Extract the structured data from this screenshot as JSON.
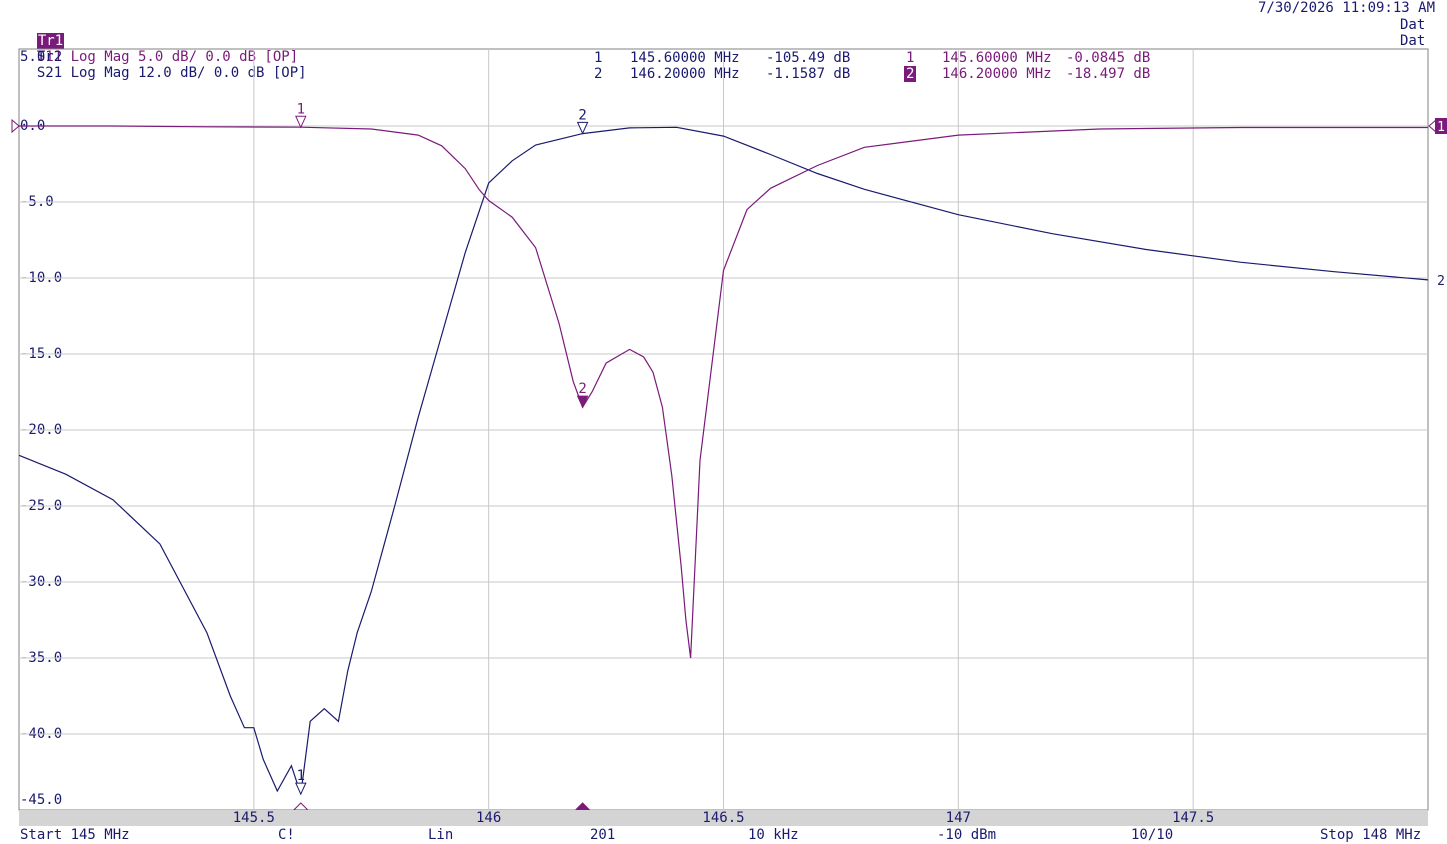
{
  "header": {
    "datetime": "7/30/2026 11:09:13 AM",
    "traces": [
      {
        "badge": "Tr1",
        "text": "S11 Log Mag 5.0 dB/ 0.0 dB [OP]",
        "right": "Dat"
      },
      {
        "badge": "Tr2",
        "text": "S21 Log Mag 12.0 dB/ 0.0 dB [OP]",
        "right": "Dat"
      }
    ]
  },
  "marker_table": {
    "tr2": [
      {
        "num": "1",
        "freq": "145.60000 MHz",
        "val": "-105.49 dB"
      },
      {
        "num": "2",
        "freq": "146.20000 MHz",
        "val": "-1.1587 dB"
      }
    ],
    "tr1": [
      {
        "num": "1",
        "freq": "145.60000 MHz",
        "val": "-0.0845 dB"
      },
      {
        "num": "2",
        "freq": "146.20000 MHz",
        "val": "-18.497 dB"
      }
    ]
  },
  "colors": {
    "tr1": "#7a1a7a",
    "tr2": "#1a1a6e",
    "grid": "#c8c8c8",
    "frame": "#808080",
    "xbar": "#d4d4d4"
  },
  "ref_labels": {
    "tr1": "1",
    "tr2": "2"
  },
  "chart_data": {
    "type": "line",
    "xlabel": "",
    "ylabel": "",
    "xlim": [
      145,
      148
    ],
    "ylim": [
      -45,
      5
    ],
    "xticks": [
      145.5,
      146,
      146.5,
      147,
      147.5
    ],
    "xtick_labels": [
      "145.5",
      "146",
      "146.5",
      "147",
      "147.5"
    ],
    "yticks": [
      5,
      0,
      -5,
      -10,
      -15,
      -20,
      -25,
      -30,
      -35,
      -40,
      -45
    ],
    "ytick_labels": [
      "5.0",
      "0.0",
      "-5.0",
      "-10.0",
      "-15.0",
      "-20.0",
      "-25.0",
      "-30.0",
      "-35.0",
      "-40.0",
      "-45.0"
    ],
    "grid": true,
    "series": [
      {
        "name": "S11",
        "x": [
          145.0,
          145.2,
          145.4,
          145.6,
          145.75,
          145.85,
          145.9,
          145.95,
          145.98,
          146.0,
          146.05,
          146.1,
          146.15,
          146.18,
          146.2,
          146.22,
          146.25,
          146.3,
          146.33,
          146.35,
          146.37,
          146.39,
          146.41,
          146.42,
          146.43,
          146.45,
          146.5,
          146.55,
          146.6,
          146.7,
          146.8,
          147.0,
          147.3,
          147.6,
          148.0
        ],
        "y": [
          0.0,
          0.0,
          -0.05,
          -0.08,
          -0.2,
          -0.6,
          -1.3,
          -2.8,
          -4.2,
          -4.9,
          -6.0,
          -8.0,
          -13.0,
          -16.8,
          -18.5,
          -17.5,
          -15.6,
          -14.7,
          -15.2,
          -16.2,
          -18.5,
          -23.0,
          -29.0,
          -32.5,
          -35.0,
          -22.0,
          -9.5,
          -5.5,
          -4.1,
          -2.6,
          -1.4,
          -0.6,
          -0.2,
          -0.1,
          -0.1
        ]
      },
      {
        "name": "S21",
        "x": [
          145.0,
          145.1,
          145.2,
          145.3,
          145.4,
          145.45,
          145.48,
          145.5,
          145.52,
          145.55,
          145.58,
          145.6,
          145.62,
          145.65,
          145.68,
          145.7,
          145.72,
          145.75,
          145.8,
          145.85,
          145.9,
          145.95,
          146.0,
          146.05,
          146.1,
          146.2,
          146.3,
          146.4,
          146.5,
          146.6,
          146.7,
          146.8,
          147.0,
          147.2,
          147.4,
          147.6,
          147.8,
          148.0
        ],
        "y": [
          -52.0,
          -55.0,
          -59.0,
          -66.0,
          -80.0,
          -90.0,
          -95.0,
          -95.0,
          -100.0,
          -105.0,
          -101.0,
          -105.5,
          -94.0,
          -92.0,
          -94.0,
          -86.0,
          -80.0,
          -73.5,
          -60.0,
          -46.0,
          -33.0,
          -20.0,
          -9.0,
          -5.5,
          -3.0,
          -1.2,
          -0.3,
          -0.2,
          -1.6,
          -4.5,
          -7.5,
          -10.0,
          -14.0,
          -17.0,
          -19.5,
          -21.5,
          -23.0,
          -24.3
        ]
      }
    ],
    "markers": [
      {
        "trace": "S11",
        "num": "1",
        "x": 145.6,
        "y": -0.0845
      },
      {
        "trace": "S11",
        "num": "2",
        "x": 146.2,
        "y": -18.497
      },
      {
        "trace": "S21",
        "num": "1",
        "x": 145.6,
        "y": -105.49
      },
      {
        "trace": "S21",
        "num": "2",
        "x": 146.2,
        "y": -1.1587
      }
    ],
    "tr2_scale": {
      "div": 12.0,
      "ref": 0.0
    }
  },
  "status_bar": {
    "start": "Start 145 MHz",
    "channel": "C!",
    "sweep_type": "Lin",
    "points": "201",
    "ifbw": "10 kHz",
    "power": "-10 dBm",
    "avg": "10/10",
    "stop": "Stop 148 MHz"
  }
}
